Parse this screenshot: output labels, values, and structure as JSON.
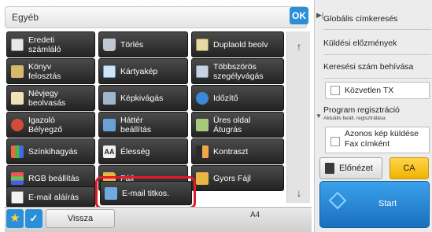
{
  "header": {
    "title": "Egyéb",
    "ok_label": "OK"
  },
  "grid": {
    "rows": [
      [
        {
          "label": "Eredeti\nszámláló",
          "icon": "original-counter-icon"
        },
        {
          "label": "Törlés",
          "icon": "erase-icon"
        },
        {
          "label": "Duplaold beolv",
          "icon": "duplex-scan-icon"
        }
      ],
      [
        {
          "label": "Könyv\nfelosztás",
          "icon": "book-divide-icon"
        },
        {
          "label": "Kártyakép",
          "icon": "card-shot-icon"
        },
        {
          "label": "Többszörös\nszegélyvágás",
          "icon": "multi-crop-icon"
        }
      ],
      [
        {
          "label": "Névjegy\nbeolvasás",
          "icon": "business-card-icon"
        },
        {
          "label": "Képkivágás",
          "icon": "image-crop-icon"
        },
        {
          "label": "Időzítő",
          "icon": "clock-icon"
        }
      ],
      [
        {
          "label": "Igazoló\nBélyegző",
          "icon": "stamp-icon"
        },
        {
          "label": "Háttér\nbeállítás",
          "icon": "background-icon"
        },
        {
          "label": "Üres oldal\nÁtugrás",
          "icon": "blank-page-icon"
        }
      ],
      [
        {
          "label": "Színkihagyás",
          "icon": "color-skip-icon"
        },
        {
          "label": "Élesség",
          "icon": "sharpness-icon",
          "glyph": "AA"
        },
        {
          "label": "Kontraszt",
          "icon": "contrast-icon"
        }
      ],
      [
        {
          "label": "RGB beállítás",
          "icon": "rgb-adjust-icon"
        },
        {
          "label": "Fájl",
          "icon": "folder-icon"
        },
        {
          "label": "Gyors Fájl",
          "icon": "quick-file-icon"
        }
      ],
      [
        {
          "label": "E-mail aláírás",
          "icon": "email-sign-icon"
        },
        {
          "label": "E-mail titkos.",
          "icon": "email-encrypt-icon"
        }
      ]
    ]
  },
  "bottom": {
    "back_label": "Vissza",
    "paper_size": "A4"
  },
  "right_panel": {
    "items": [
      {
        "label": "Globális címkeresés"
      },
      {
        "label": "Küldési előzmények"
      },
      {
        "label": "Keresési szám behívása"
      }
    ],
    "direct_tx_label": "Közvetlen TX",
    "program_label": "Program regisztráció",
    "program_sub": "Aktuális beáll. regisztrálása",
    "same_image_label": "Azonos kép küldése\nFax címként",
    "preview_label": "Előnézet",
    "ca_label": "CA",
    "start_label": "Start"
  }
}
